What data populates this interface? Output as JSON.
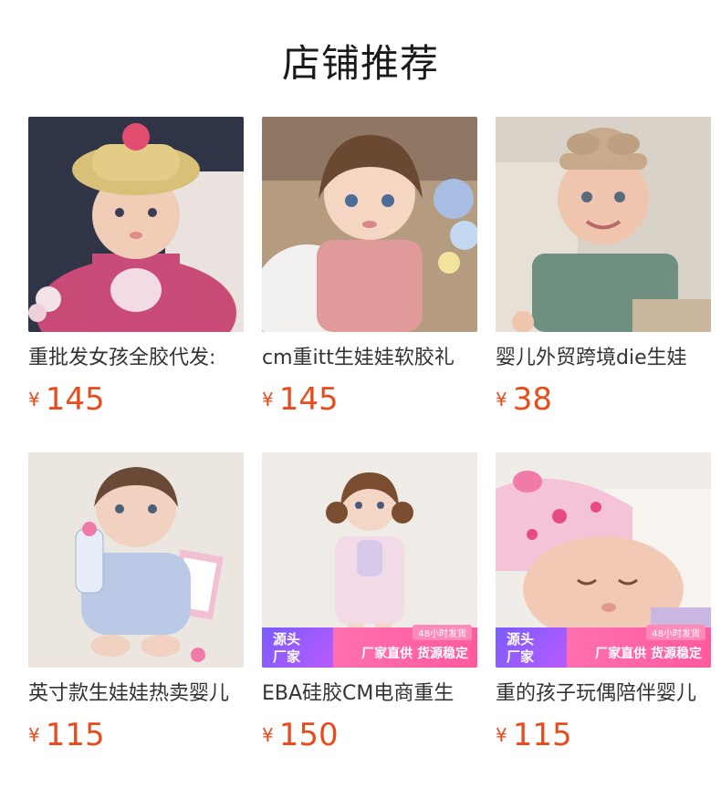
{
  "page": {
    "title": "店铺推荐",
    "currency": "¥"
  },
  "products": [
    {
      "name": "重批发女孩全胶代发:",
      "price": "145"
    },
    {
      "name": "cm重itt生娃娃软胶礼",
      "price": "145"
    },
    {
      "name": "婴儿外贸跨境die生娃",
      "price": "38"
    },
    {
      "name": "英寸款生娃娃热卖婴儿",
      "price": "115"
    },
    {
      "name": "EBA硅胶CM电商重生",
      "price": "150",
      "badge": {
        "left_top": "源头",
        "left_bottom": "厂家",
        "top": "48小时发货",
        "main": "厂家直供 货源稳定"
      }
    },
    {
      "name": "重的孩子玩偶陪伴婴儿",
      "price": "115",
      "badge": {
        "left_top": "源头",
        "left_bottom": "厂家",
        "top": "48小时发货",
        "main": "厂家直供 货源稳定"
      }
    }
  ]
}
